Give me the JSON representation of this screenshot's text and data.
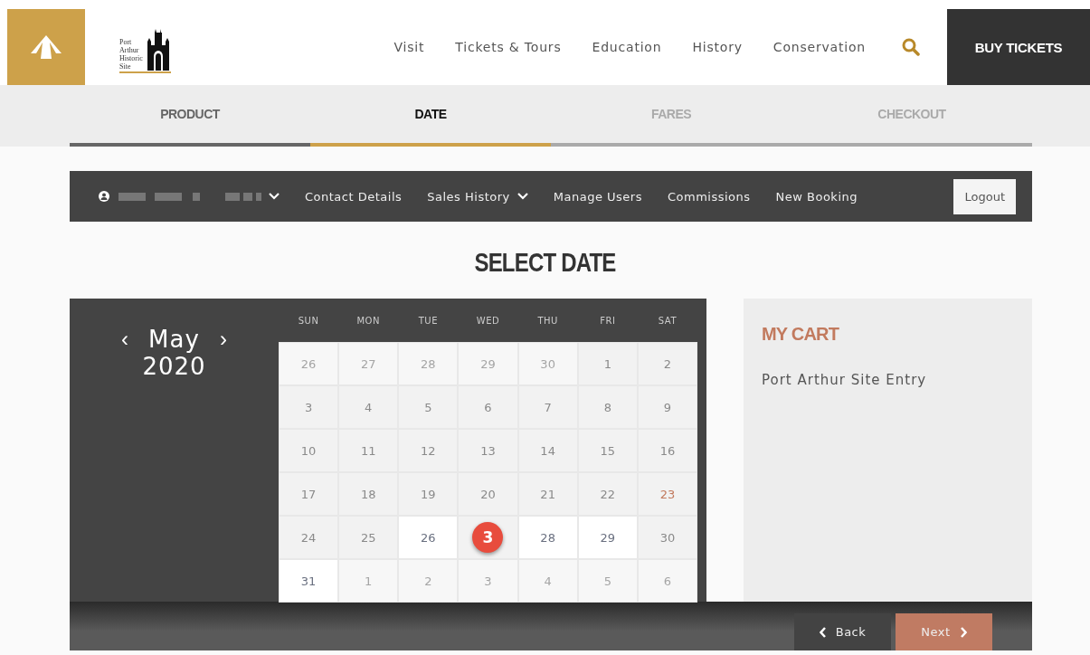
{
  "logo": {
    "lines": [
      "Port",
      "Arthur",
      "Historic",
      "Site"
    ]
  },
  "nav": {
    "items": [
      "Visit",
      "Tickets & Tours",
      "Education",
      "History",
      "Conservation"
    ],
    "cta": "BUY TICKETS"
  },
  "steps": [
    {
      "label": "PRODUCT",
      "kind": "done"
    },
    {
      "label": "DATE",
      "kind": "current"
    },
    {
      "label": "FARES",
      "kind": "todo"
    },
    {
      "label": "CHECKOUT",
      "kind": "todo"
    }
  ],
  "user_bar": {
    "links": [
      {
        "label": "Contact Details",
        "dropdown": false
      },
      {
        "label": "Sales History",
        "dropdown": true
      },
      {
        "label": "Manage Users",
        "dropdown": false
      },
      {
        "label": "Commissions",
        "dropdown": false
      },
      {
        "label": "New Booking",
        "dropdown": false
      }
    ],
    "logout": "Logout"
  },
  "heading": "SELECT DATE",
  "calendar": {
    "month": "May",
    "year": "2020",
    "prev": "‹",
    "next": "›",
    "weekdays": [
      "SUN",
      "MON",
      "TUE",
      "WED",
      "THU",
      "FRI",
      "SAT"
    ],
    "days": [
      {
        "label": "26",
        "kind": "outside"
      },
      {
        "label": "27",
        "kind": "outside"
      },
      {
        "label": "28",
        "kind": "outside"
      },
      {
        "label": "29",
        "kind": "outside"
      },
      {
        "label": "30",
        "kind": "outside"
      },
      {
        "label": "1",
        "kind": "past"
      },
      {
        "label": "2",
        "kind": "past"
      },
      {
        "label": "3",
        "kind": "past"
      },
      {
        "label": "4",
        "kind": "past"
      },
      {
        "label": "5",
        "kind": "past"
      },
      {
        "label": "6",
        "kind": "past"
      },
      {
        "label": "7",
        "kind": "past"
      },
      {
        "label": "8",
        "kind": "past"
      },
      {
        "label": "9",
        "kind": "past"
      },
      {
        "label": "10",
        "kind": "past"
      },
      {
        "label": "11",
        "kind": "past"
      },
      {
        "label": "12",
        "kind": "past"
      },
      {
        "label": "13",
        "kind": "past"
      },
      {
        "label": "14",
        "kind": "past"
      },
      {
        "label": "15",
        "kind": "past"
      },
      {
        "label": "16",
        "kind": "past"
      },
      {
        "label": "17",
        "kind": "past"
      },
      {
        "label": "18",
        "kind": "past"
      },
      {
        "label": "19",
        "kind": "past"
      },
      {
        "label": "20",
        "kind": "past"
      },
      {
        "label": "21",
        "kind": "past"
      },
      {
        "label": "22",
        "kind": "past"
      },
      {
        "label": "23",
        "kind": "today"
      },
      {
        "label": "24",
        "kind": "past"
      },
      {
        "label": "25",
        "kind": "past"
      },
      {
        "label": "26",
        "kind": "available"
      },
      {
        "kind": "marked",
        "badge": "3"
      },
      {
        "label": "28",
        "kind": "available"
      },
      {
        "label": "29",
        "kind": "available"
      },
      {
        "label": "30",
        "kind": "past"
      },
      {
        "label": "31",
        "kind": "available"
      },
      {
        "label": "1",
        "kind": "outside"
      },
      {
        "label": "2",
        "kind": "outside"
      },
      {
        "label": "3",
        "kind": "outside"
      },
      {
        "label": "4",
        "kind": "outside"
      },
      {
        "label": "5",
        "kind": "outside"
      },
      {
        "label": "6",
        "kind": "outside"
      }
    ]
  },
  "cart": {
    "title": "MY CART",
    "items": [
      "Port Arthur Site Entry"
    ]
  },
  "footer": {
    "back": "Back",
    "next": "Next"
  }
}
